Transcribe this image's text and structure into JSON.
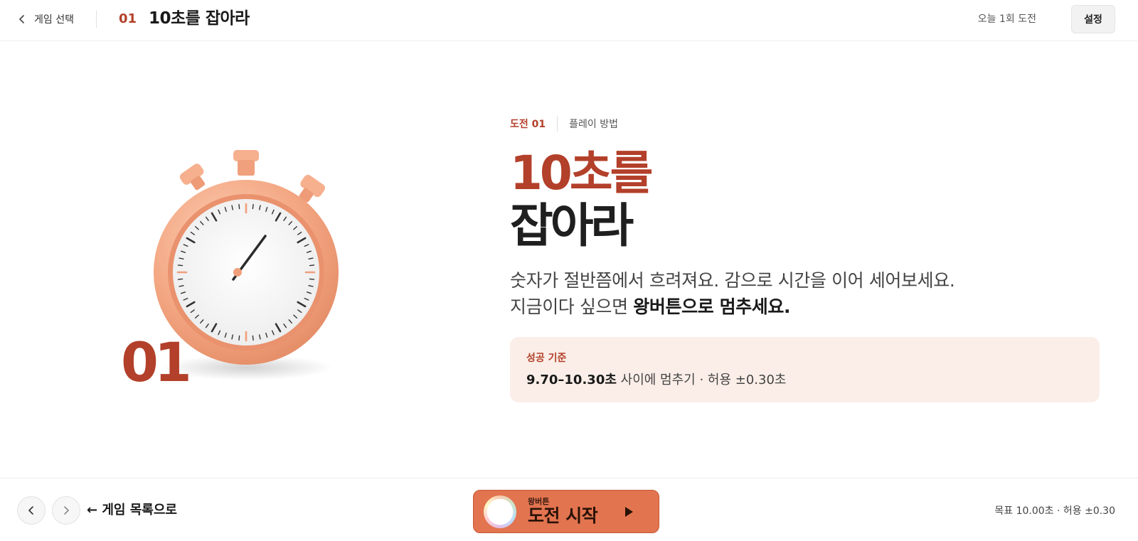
{
  "header": {
    "back_label": "게임 선택",
    "game_number": "01",
    "game_title": "10초를 잡아라",
    "daily_count": "오늘 1회 도전",
    "settings_label": "설정"
  },
  "hero": {
    "big_number": "01"
  },
  "content": {
    "challenge_crumb": "도전 01",
    "howto_crumb": "플레이 방법",
    "title_line1": "10초를",
    "title_line2": "잡아라",
    "desc_line1": "숫자가 절반쯤에서 흐려져요. 감으로 시간을 이어 세어보세요.",
    "desc_line2_plain": "지금이다 싶으면 ",
    "desc_line2_bold": "왕버튼으로 멈추세요.",
    "criteria_label": "성공 기준",
    "criteria_range": "9.70–10.30초",
    "criteria_rest": " 사이에 멈추기 · 허용 ±0.30초"
  },
  "footer": {
    "list_link": "← 게임 목록으로",
    "start_small": "왕버튼",
    "start_main": "도전 시작",
    "target_text": "목표 10.00초 · 허용 ±0.30"
  },
  "colors": {
    "accent": "#b3402a",
    "button": "#e2744f",
    "criteria_bg": "#fbeee8",
    "stopwatch_body": "#f4a884"
  },
  "icons": {
    "back": "chevron-left-icon",
    "prev": "chevron-left-icon",
    "next": "chevron-right-icon",
    "play": "play-icon",
    "hero": "stopwatch-icon"
  }
}
